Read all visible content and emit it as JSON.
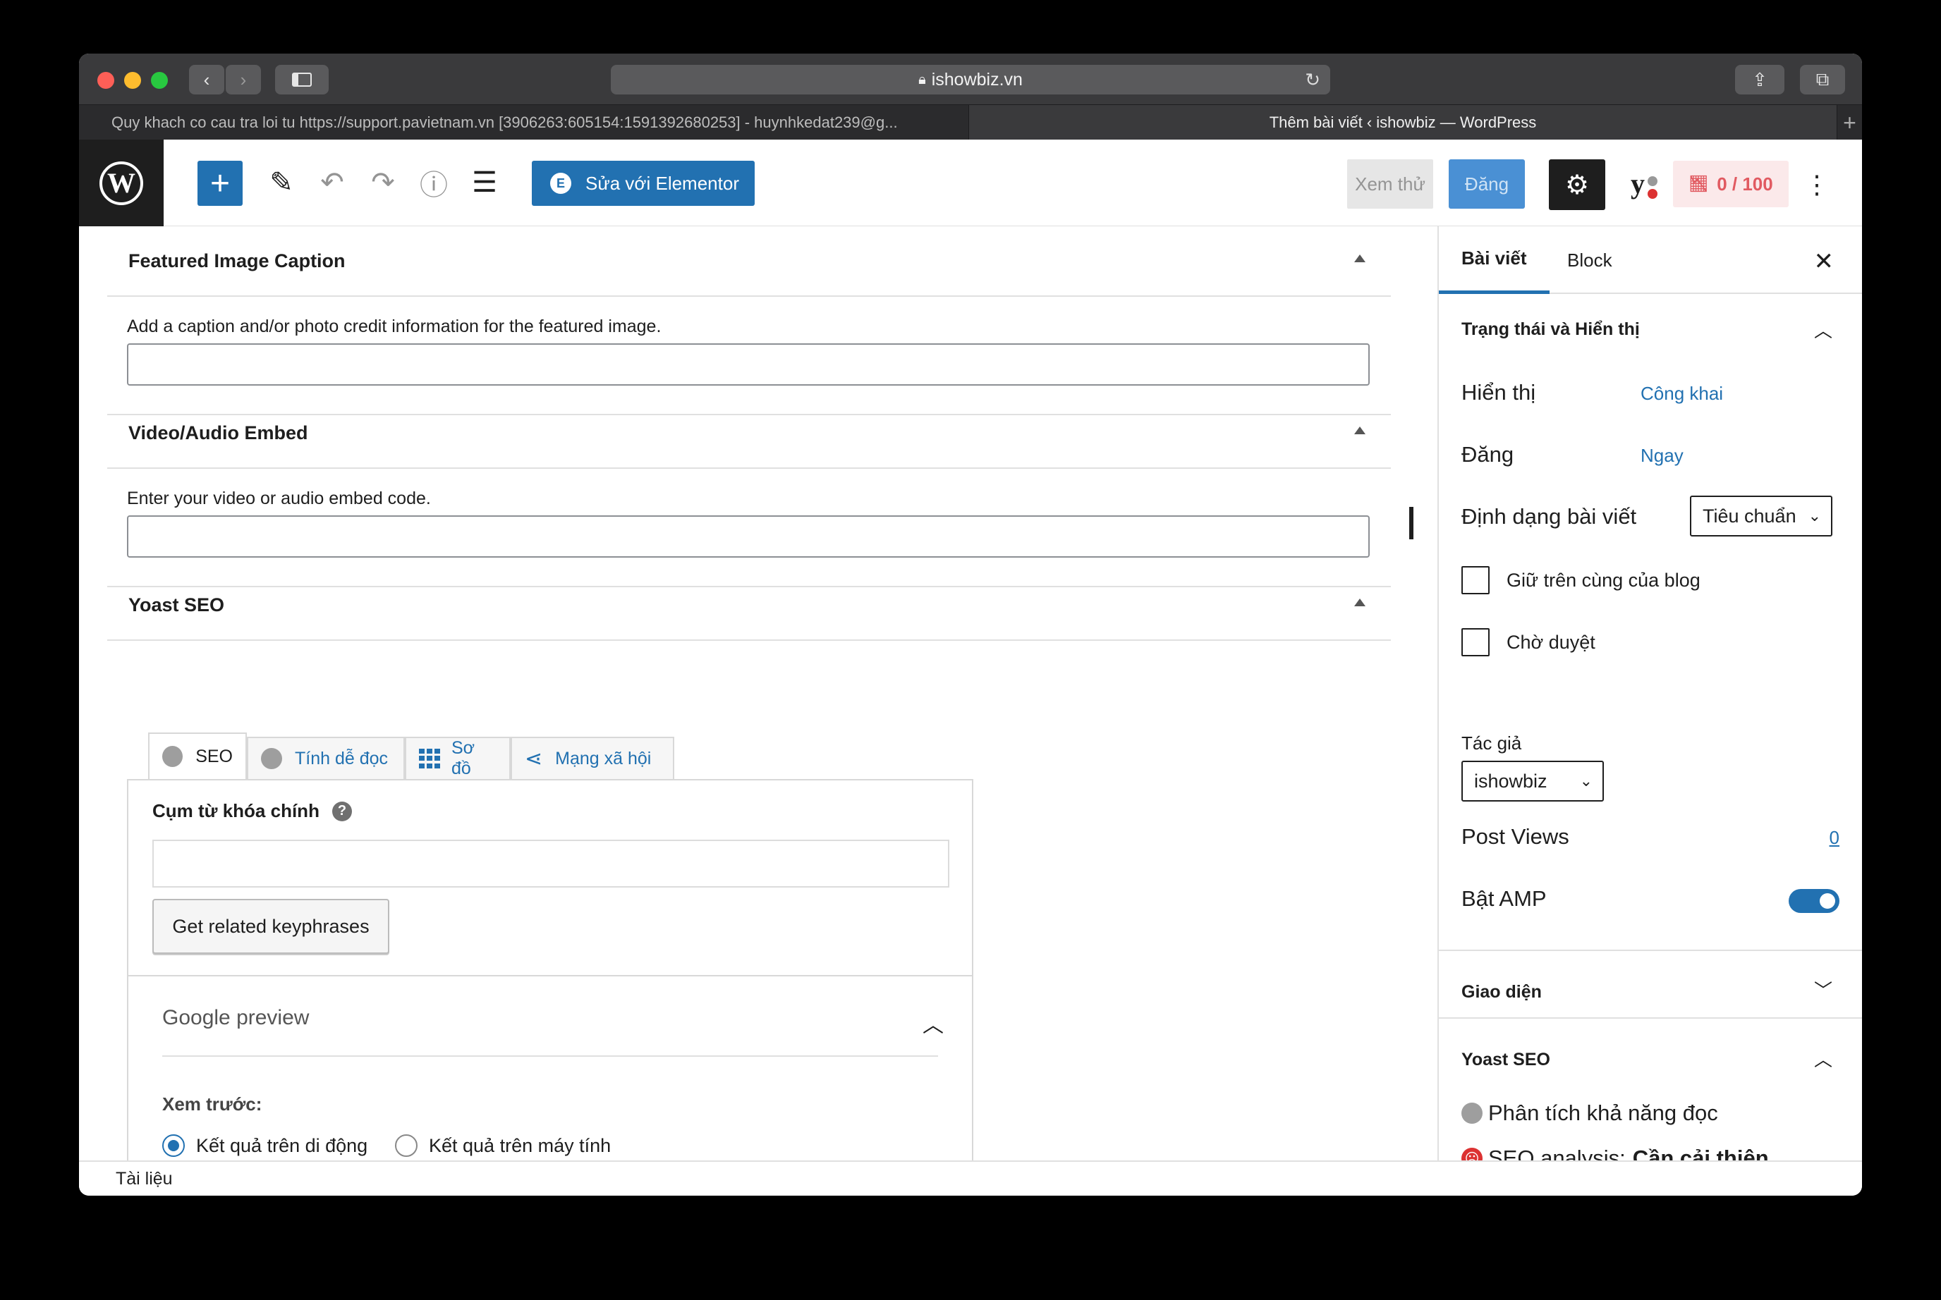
{
  "browser": {
    "url": "ishowbiz.vn",
    "tabs": [
      {
        "title": "Quy khach co cau tra loi tu https://support.pavietnam.vn [3906263:605154:1591392680253] - huynhkedat239@g..."
      },
      {
        "title": "Thêm bài viết ‹ ishowbiz — WordPress"
      }
    ]
  },
  "toolbar": {
    "elementor_label": "Sửa với Elementor",
    "preview_label": "Xem thử",
    "publish_label": "Đăng",
    "seo_score": "0 / 100"
  },
  "panels": {
    "featured_caption": {
      "title": "Featured Image Caption",
      "description": "Add a caption and/or photo credit information for the featured image."
    },
    "video_embed": {
      "title": "Video/Audio Embed",
      "description": "Enter your video or audio embed code."
    },
    "yoast": {
      "title": "Yoast SEO",
      "tabs": [
        "SEO",
        "Tính dễ đọc",
        "Sơ đồ",
        "Mạng xã hội"
      ],
      "keyphrase_label": "Cụm từ khóa chính",
      "related_button": "Get related keyphrases",
      "google_preview": "Google preview",
      "preview_label": "Xem trước:",
      "radio_mobile": "Kết quả trên di động",
      "radio_desktop": "Kết quả trên máy tính"
    }
  },
  "sidebar": {
    "tab_post": "Bài viết",
    "tab_block": "Block",
    "status_title": "Trạng thái và Hiển thị",
    "visibility_label": "Hiển thị",
    "visibility_value": "Công khai",
    "publish_label": "Đăng",
    "publish_value": "Ngay",
    "format_label": "Định dạng bài viết",
    "format_value": "Tiêu chuẩn",
    "sticky_label": "Giữ trên cùng của blog",
    "pending_label": "Chờ duyệt",
    "author_label": "Tác giả",
    "author_value": "ishowbiz",
    "views_label": "Post Views",
    "views_value": "0",
    "amp_label": "Bật AMP",
    "amp_enabled": true,
    "theme_title": "Giao diện",
    "yoast_title": "Yoast SEO",
    "readability": "Phân tích khả năng đọc",
    "seo_analysis_prefix": "SEO analysis:",
    "seo_analysis_value": "Cần cải thiện"
  },
  "footer": {
    "breadcrumb": "Tài liệu"
  }
}
